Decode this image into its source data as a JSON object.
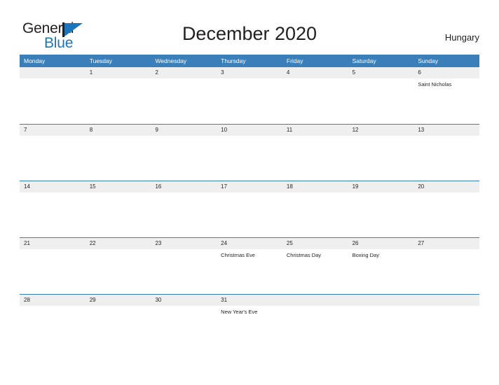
{
  "brand": {
    "name_part1": "General",
    "name_part2": "Blue",
    "color_dark": "#231f20",
    "color_blue": "#1b75bb"
  },
  "header": {
    "title": "December 2020",
    "region": "Hungary"
  },
  "theme": {
    "header_blue": "#3a7fba",
    "band_gray": "#efefef",
    "text_dark": "#231f20"
  },
  "calendar": {
    "weekdays": [
      "Monday",
      "Tuesday",
      "Wednesday",
      "Thursday",
      "Friday",
      "Saturday",
      "Sunday"
    ],
    "weeks": [
      [
        {
          "day": "",
          "event": ""
        },
        {
          "day": "1",
          "event": ""
        },
        {
          "day": "2",
          "event": ""
        },
        {
          "day": "3",
          "event": ""
        },
        {
          "day": "4",
          "event": ""
        },
        {
          "day": "5",
          "event": ""
        },
        {
          "day": "6",
          "event": "Saint Nicholas"
        }
      ],
      [
        {
          "day": "7",
          "event": ""
        },
        {
          "day": "8",
          "event": ""
        },
        {
          "day": "9",
          "event": ""
        },
        {
          "day": "10",
          "event": ""
        },
        {
          "day": "11",
          "event": ""
        },
        {
          "day": "12",
          "event": ""
        },
        {
          "day": "13",
          "event": ""
        }
      ],
      [
        {
          "day": "14",
          "event": ""
        },
        {
          "day": "15",
          "event": ""
        },
        {
          "day": "16",
          "event": ""
        },
        {
          "day": "17",
          "event": ""
        },
        {
          "day": "18",
          "event": ""
        },
        {
          "day": "19",
          "event": ""
        },
        {
          "day": "20",
          "event": ""
        }
      ],
      [
        {
          "day": "21",
          "event": ""
        },
        {
          "day": "22",
          "event": ""
        },
        {
          "day": "23",
          "event": ""
        },
        {
          "day": "24",
          "event": "Christmas Eve"
        },
        {
          "day": "25",
          "event": "Christmas Day"
        },
        {
          "day": "26",
          "event": "Boxing Day"
        },
        {
          "day": "27",
          "event": ""
        }
      ],
      [
        {
          "day": "28",
          "event": ""
        },
        {
          "day": "29",
          "event": ""
        },
        {
          "day": "30",
          "event": ""
        },
        {
          "day": "31",
          "event": "New Year's Eve"
        },
        {
          "day": "",
          "event": ""
        },
        {
          "day": "",
          "event": ""
        },
        {
          "day": "",
          "event": ""
        }
      ]
    ]
  }
}
